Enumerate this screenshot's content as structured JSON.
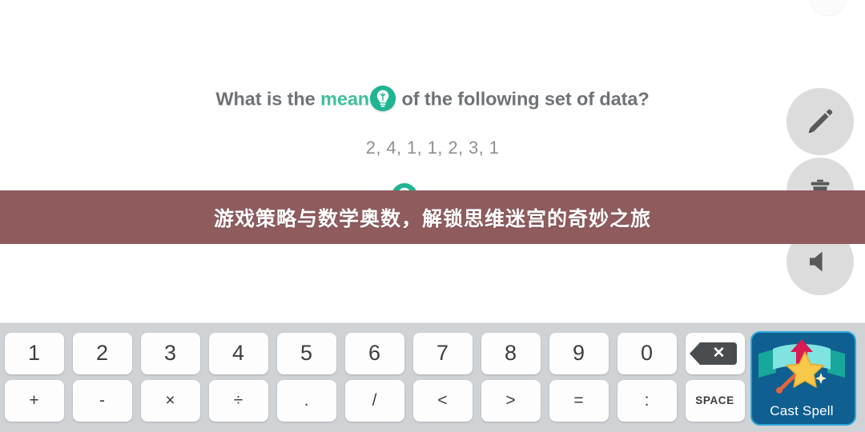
{
  "question": {
    "prefix": "What is the ",
    "highlight_word": "mean",
    "suffix": " of the following set of data?",
    "hint_icon": "lightbulb-icon",
    "highlight_color": "#3fbfa0",
    "text_color": "#6f7376"
  },
  "data_set": {
    "values_text": "2, 4, 1, 1, 2, 3, 1",
    "values": [
      2,
      4,
      1,
      1,
      2,
      3,
      1
    ]
  },
  "hint_bulb_2": {
    "icon": "lightbulb-icon"
  },
  "actions": [
    {
      "name": "edit",
      "icon": "pencil-icon",
      "label": "Edit"
    },
    {
      "name": "delete",
      "icon": "trash-icon",
      "label": "Delete"
    },
    {
      "name": "sound",
      "icon": "speaker-icon",
      "label": "Sound"
    }
  ],
  "promo_banner": {
    "text": "游戏策略与数学奥数，解锁思维迷宫的奇妙之旅",
    "background_color": "#8f5b5d",
    "text_color": "#ffffff"
  },
  "keyboard": {
    "background_color": "#d0d3d6",
    "row1": [
      {
        "label": "1",
        "name": "key-1",
        "type": "digit"
      },
      {
        "label": "2",
        "name": "key-2",
        "type": "digit"
      },
      {
        "label": "3",
        "name": "key-3",
        "type": "digit"
      },
      {
        "label": "4",
        "name": "key-4",
        "type": "digit"
      },
      {
        "label": "5",
        "name": "key-5",
        "type": "digit"
      },
      {
        "label": "6",
        "name": "key-6",
        "type": "digit"
      },
      {
        "label": "7",
        "name": "key-7",
        "type": "digit"
      },
      {
        "label": "8",
        "name": "key-8",
        "type": "digit"
      },
      {
        "label": "9",
        "name": "key-9",
        "type": "digit"
      },
      {
        "label": "0",
        "name": "key-0",
        "type": "digit"
      },
      {
        "label": "",
        "name": "key-backspace",
        "type": "backspace"
      }
    ],
    "row2": [
      {
        "label": "+",
        "name": "key-plus",
        "type": "operator"
      },
      {
        "label": "-",
        "name": "key-minus",
        "type": "operator"
      },
      {
        "label": "×",
        "name": "key-multiply",
        "type": "operator"
      },
      {
        "label": "÷",
        "name": "key-divide",
        "type": "operator"
      },
      {
        "label": ".",
        "name": "key-period",
        "type": "operator"
      },
      {
        "label": "/",
        "name": "key-slash",
        "type": "operator"
      },
      {
        "label": "<",
        "name": "key-less-than",
        "type": "operator"
      },
      {
        "label": ">",
        "name": "key-greater-than",
        "type": "operator"
      },
      {
        "label": "=",
        "name": "key-equals",
        "type": "operator"
      },
      {
        "label": ":",
        "name": "key-colon",
        "type": "operator"
      },
      {
        "label": "SPACE",
        "name": "key-space",
        "type": "space"
      }
    ]
  },
  "cast_spell": {
    "label": "Cast Spell",
    "background_color": "#0f5f90",
    "border_color": "#2aa7d8",
    "icon": "magic-wand-icon"
  }
}
